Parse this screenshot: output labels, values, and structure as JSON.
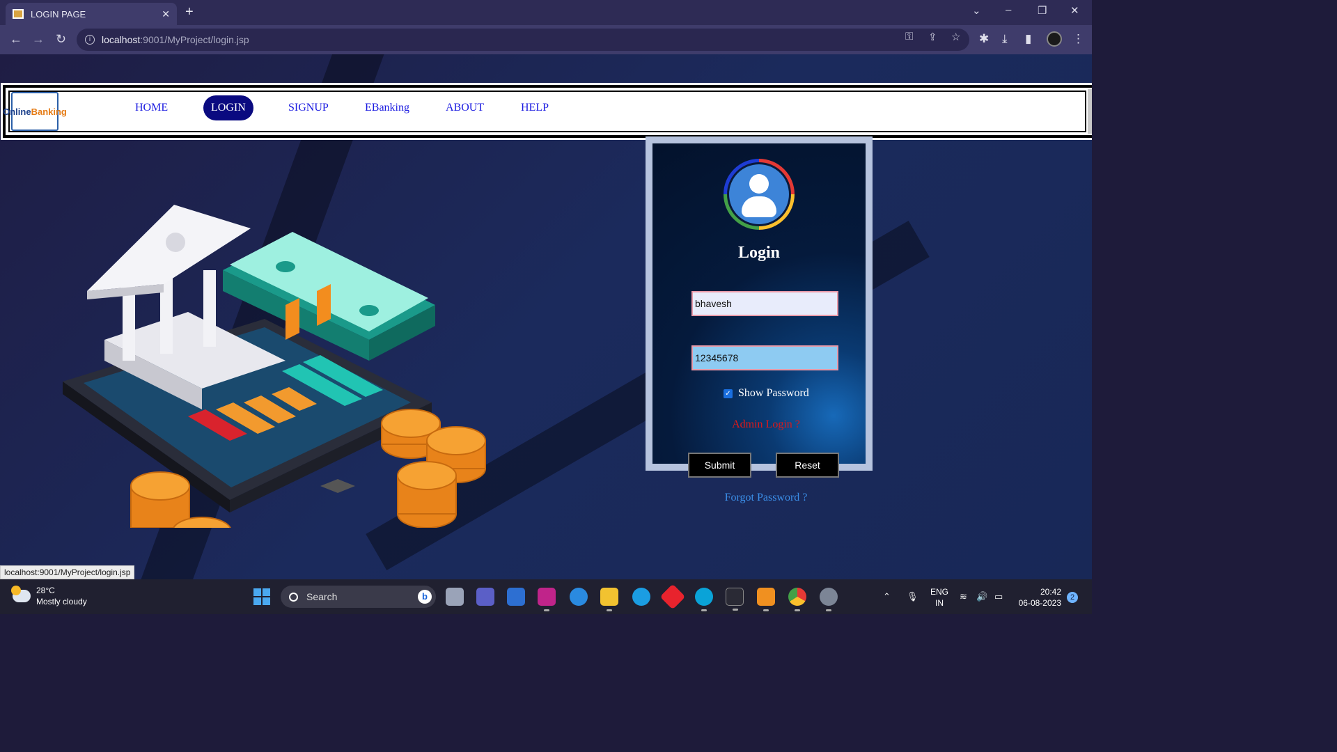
{
  "browser": {
    "tab_title": "LOGIN PAGE",
    "url_host": "localhost",
    "url_rest": ":9001/MyProject/login.jsp"
  },
  "nav": {
    "logo_text_a": "Online",
    "logo_text_b": "Banking",
    "links": [
      "HOME",
      "LOGIN",
      "SIGNUP",
      "EBanking",
      "ABOUT",
      "HELP"
    ],
    "active": "LOGIN"
  },
  "login": {
    "title": "Login",
    "username_value": "bhavesh",
    "password_value": "12345678",
    "show_password_label": "Show Password",
    "show_password_checked": true,
    "admin_link": "Admin Login ?",
    "submit_label": "Submit",
    "reset_label": "Reset",
    "forgot_link": "Forgot Password ?"
  },
  "status_url": "localhost:9001/MyProject/login.jsp",
  "taskbar": {
    "temperature": "28°C",
    "weather": "Mostly cloudy",
    "search_placeholder": "Search",
    "lang_top": "ENG",
    "lang_bottom": "IN",
    "time": "20:42",
    "date": "06-08-2023",
    "notifications": "2"
  },
  "colors": {
    "active_nav_bg": "#0a0a80",
    "nav_link": "#1a1ae0",
    "admin_link": "#e01818",
    "forgot_link": "#3b8ee8"
  }
}
